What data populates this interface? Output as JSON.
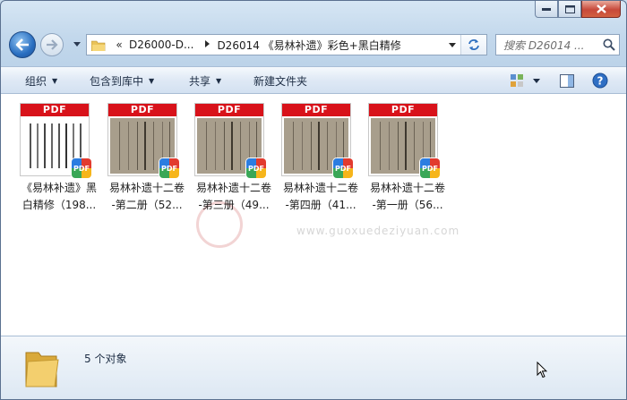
{
  "window": {
    "caption_buttons": [
      "minimize",
      "maximize",
      "close"
    ]
  },
  "address_bar": {
    "crumbs": [
      "D26000-D...",
      "D26014 《易林补遗》彩色+黑白精修"
    ],
    "overflow_marker": "«"
  },
  "search": {
    "placeholder": "搜索 D26014 ..."
  },
  "toolbar": {
    "organize": "组织",
    "include_in_library": "包含到库中",
    "share": "共享",
    "new_folder": "新建文件夹"
  },
  "files": [
    {
      "line1": "《易林补遗》黑",
      "line2": "白精修（198...",
      "style": "bw",
      "badge_text": "PDF",
      "header": "PDF"
    },
    {
      "line1": "易林补遗十二卷",
      "line2": "-第二册（52...",
      "style": "old",
      "badge_text": "PDF",
      "header": "PDF"
    },
    {
      "line1": "易林补遗十二卷",
      "line2": "-第三册（49...",
      "style": "old",
      "badge_text": "PDF",
      "header": "PDF"
    },
    {
      "line1": "易林补遗十二卷",
      "line2": "-第四册（41...",
      "style": "old",
      "badge_text": "PDF",
      "header": "PDF"
    },
    {
      "line1": "易林补遗十二卷",
      "line2": "-第一册（56...",
      "style": "old",
      "badge_text": "PDF",
      "header": "PDF"
    }
  ],
  "watermark": {
    "text": "www.guoxuedeziyuan.com"
  },
  "status": {
    "count_text": "5 个对象"
  },
  "colors": {
    "pdf_red": "#d8121a",
    "toolbar_text": "#1e2e45",
    "window_frame": "#bcd3e9"
  }
}
